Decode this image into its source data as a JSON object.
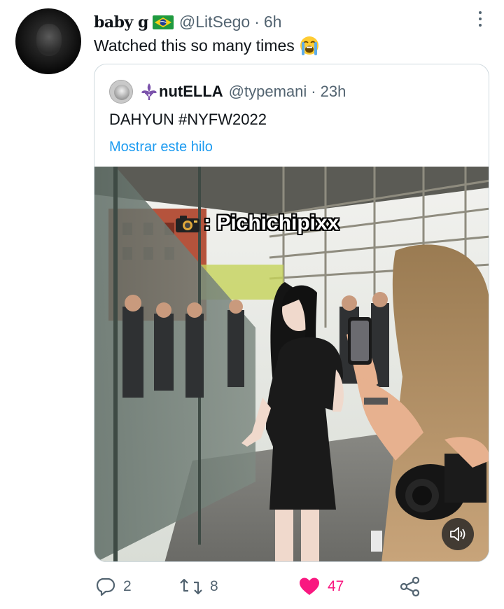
{
  "tweet": {
    "display_name": "baby g",
    "flag_icon": "brazil-flag-icon",
    "handle": "@LitSego",
    "separator": "·",
    "time": "6h",
    "text": "Watched this so many times",
    "text_emoji": "loudly-crying-face-emoji"
  },
  "quoted": {
    "avatar_icon": "user-avatar",
    "name_prefix_icon": "fleur-de-lis-icon",
    "display_name": "nutELLA",
    "handle": "@typemani",
    "separator": "·",
    "time": "23h",
    "text": "DAHYUN #NYFW2022",
    "show_thread_link": "Mostrar este hilo",
    "media": {
      "type": "video",
      "caption_icon": "camera-icon",
      "caption_text": ": Pichichipixx",
      "sound_icon": "speaker-muted-icon"
    }
  },
  "actions": {
    "reply_count": "2",
    "retweet_count": "8",
    "like_count": "47",
    "liked": true,
    "like_color": "#f91880",
    "muted_color": "#536471"
  },
  "colors": {
    "link": "#1d9bf0",
    "text": "#0f1419",
    "secondary": "#536471",
    "border": "#cfd9de"
  }
}
